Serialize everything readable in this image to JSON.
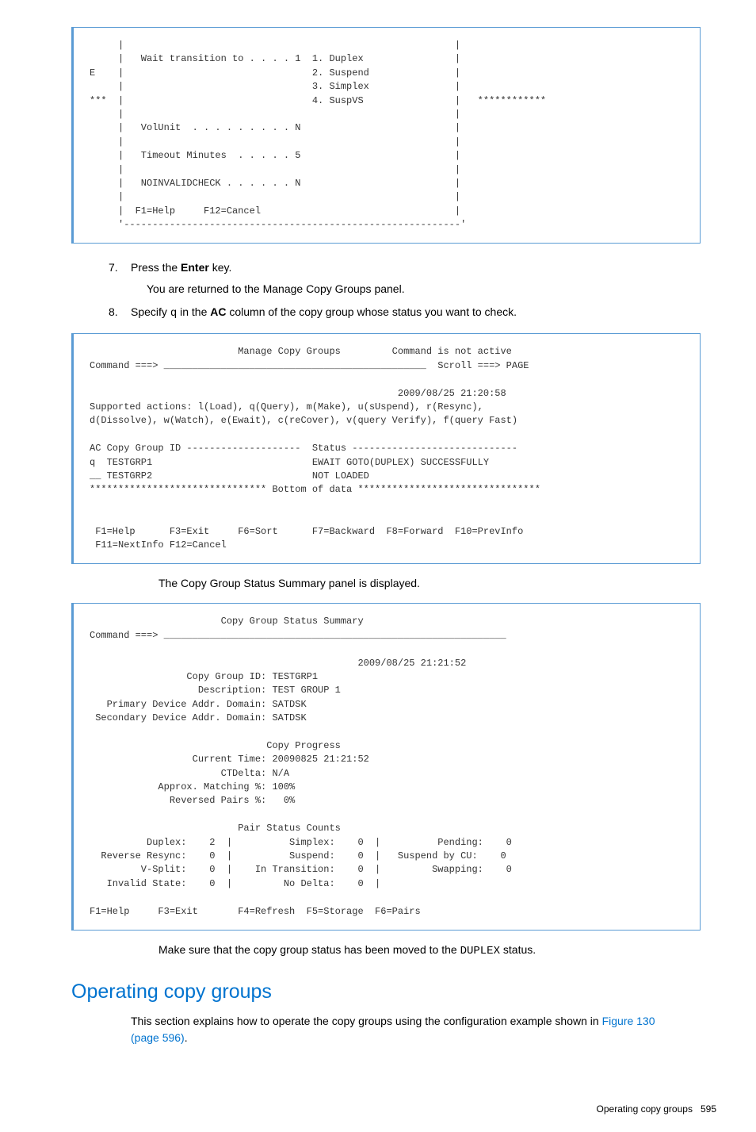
{
  "terminal1": {
    "content": "     |                                                          |\n     |   Wait transition to . . . . 1  1. Duplex                |\nE    |                                 2. Suspend               |\n     |                                 3. Simplex               |\n***  |                                 4. SuspVS                |   ************\n     |                                                          |\n     |   VolUnit  . . . . . . . . . N                           |\n     |                                                          |\n     |   Timeout Minutes  . . . . . 5                           |\n     |                                                          |\n     |   NOINVALIDCHECK . . . . . . N                           |\n     |                                                          |\n     |  F1=Help     F12=Cancel                                  |\n     '-----------------------------------------------------------'"
  },
  "steps": {
    "s7": {
      "num": "7.",
      "text_pre": "Press the ",
      "text_bold": "Enter",
      "text_post": " key.",
      "sub": "You are returned to the Manage Copy Groups panel."
    },
    "s8": {
      "num": "8.",
      "text_pre": "Specify ",
      "text_code": "q",
      "text_mid": " in the ",
      "text_bold": "AC",
      "text_post": " column of the copy group whose status you want to check."
    }
  },
  "terminal2": {
    "content": "                          Manage Copy Groups         Command is not active\nCommand ===> ______________________________________________  Scroll ===> PAGE\n\n                                                      2009/08/25 21:20:58\nSupported actions: l(Load), q(Query), m(Make), u(sUspend), r(Resync),\nd(Dissolve), w(Watch), e(Ewait), c(reCover), v(query Verify), f(query Fast)\n\nAC Copy Group ID --------------------  Status -----------------------------\nq  TESTGRP1                            EWAIT GOTO(DUPLEX) SUCCESSFULLY\n__ TESTGRP2                            NOT LOADED\n******************************* Bottom of data ********************************\n\n\n F1=Help      F3=Exit     F6=Sort      F7=Backward  F8=Forward  F10=PrevInfo\n F11=NextInfo F12=Cancel"
  },
  "caption1": "The Copy Group Status Summary panel is displayed.",
  "terminal3": {
    "content": "                       Copy Group Status Summary\nCommand ===> ____________________________________________________________\n\n                                               2009/08/25 21:21:52\n                 Copy Group ID: TESTGRP1\n                   Description: TEST GROUP 1\n   Primary Device Addr. Domain: SATDSK\n Secondary Device Addr. Domain: SATDSK\n\n                               Copy Progress\n                  Current Time: 20090825 21:21:52\n                       CTDelta: N/A\n            Approx. Matching %: 100%\n              Reversed Pairs %:   0%\n\n                          Pair Status Counts\n          Duplex:    2  |          Simplex:    0  |          Pending:    0\n  Reverse Resync:    0  |          Suspend:    0  |   Suspend by CU:    0\n         V-Split:    0  |    In Transition:    0  |         Swapping:    0\n   Invalid State:    0  |         No Delta:    0  |\n\nF1=Help     F3=Exit       F4=Refresh  F5=Storage  F6=Pairs"
  },
  "caption2_pre": "Make sure that the copy group status has been moved to the ",
  "caption2_code": "DUPLEX",
  "caption2_post": " status.",
  "section": {
    "heading": "Operating copy groups",
    "body_pre": "This section explains how to operate the copy groups using the configuration example shown in ",
    "body_link": "Figure 130 (page 596)",
    "body_post": "."
  },
  "footer": {
    "text": "Operating copy groups",
    "page": "595"
  }
}
